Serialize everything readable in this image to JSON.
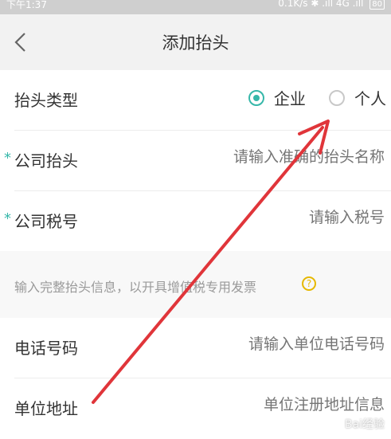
{
  "status_bar": {
    "time": "下午1:37",
    "network": "0.1K/s ✱ .ıll 4G .ıll",
    "battery": "80"
  },
  "navbar": {
    "back_icon": "chevron-left-icon",
    "title": "添加抬头"
  },
  "form": {
    "type_label": "抬头类型",
    "type_options": [
      {
        "label": "企业",
        "checked": true
      },
      {
        "label": "个人",
        "checked": false
      }
    ],
    "company_title": {
      "label": "公司抬头",
      "placeholder": "请输入准确的抬头名称"
    },
    "tax_number": {
      "label": "公司税号",
      "placeholder": "请输入税号"
    },
    "hint": "输入完整抬头信息，以开具增值税专用发票",
    "hint_icon": "question-circle-icon",
    "phone": {
      "label": "电话号码",
      "placeholder": "请输入单位电话号码"
    },
    "address": {
      "label": "单位地址",
      "placeholder": "单位注册地址信息"
    }
  },
  "watermark": "Bai经验",
  "colors": {
    "accent": "#36b7a9",
    "arrow": "#e0353a",
    "hint_icon": "#e6b800"
  }
}
